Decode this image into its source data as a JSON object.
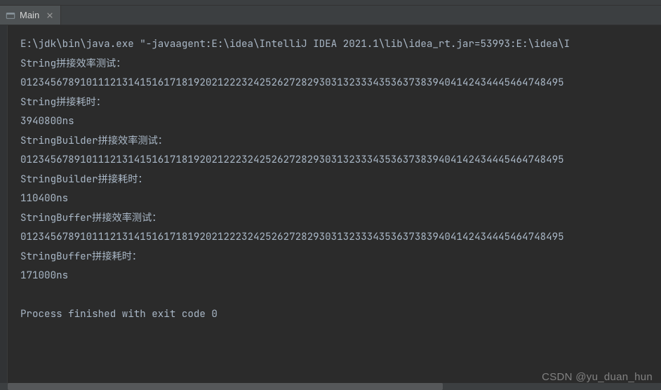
{
  "tab": {
    "label": "Main"
  },
  "console": {
    "lines": [
      "E:\\jdk\\bin\\java.exe \"-javaagent:E:\\idea\\IntelliJ IDEA 2021.1\\lib\\idea_rt.jar=53993:E:\\idea\\I",
      "String拼接效率测试：",
      "0123456789101112131415161718192021222324252627282930313233343536373839404142434445464748495",
      "String拼接耗时：",
      "3940800ns",
      "StringBuilder拼接效率测试：",
      "0123456789101112131415161718192021222324252627282930313233343536373839404142434445464748495",
      "StringBuilder拼接耗时：",
      "110400ns",
      "StringBuffer拼接效率测试：",
      "0123456789101112131415161718192021222324252627282930313233343536373839404142434445464748495",
      "StringBuffer拼接耗时：",
      "171000ns",
      "",
      "Process finished with exit code 0"
    ]
  },
  "watermark": "CSDN @yu_duan_hun"
}
